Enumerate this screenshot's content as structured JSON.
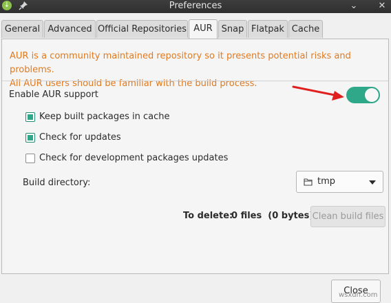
{
  "window": {
    "title": "Preferences"
  },
  "tabs": [
    "General",
    "Advanced",
    "Official Repositories",
    "AUR",
    "Snap",
    "Flatpak",
    "Cache"
  ],
  "active_tab": "AUR",
  "aur": {
    "warning_line1": "AUR is a community maintained repository so it presents potential risks and problems.",
    "warning_line2": "All AUR users should be familiar with the build process.",
    "enable_label": "Enable AUR support",
    "enable_on": true,
    "keep_cache_label": "Keep built packages in cache",
    "keep_cache_checked": true,
    "check_updates_label": "Check for updates",
    "check_updates_checked": true,
    "dev_updates_label": "Check for development packages updates",
    "dev_updates_checked": false,
    "build_dir_label": "Build directory:",
    "build_dir_value": "tmp",
    "to_delete_label": "To delete:",
    "to_delete_value": "0 files  (0 bytes)",
    "clean_button": "Clean build files"
  },
  "footer": {
    "close_button": "Close"
  },
  "watermark": "wsxdn.com",
  "colors": {
    "accent": "#2fa88a",
    "warning": "#e07a1f",
    "arrow": "#e0201f"
  },
  "icons": [
    "app-icon",
    "pin-icon",
    "chevron-down-icon",
    "close-icon",
    "folder-icon",
    "caret-down-icon",
    "red-arrow"
  ]
}
